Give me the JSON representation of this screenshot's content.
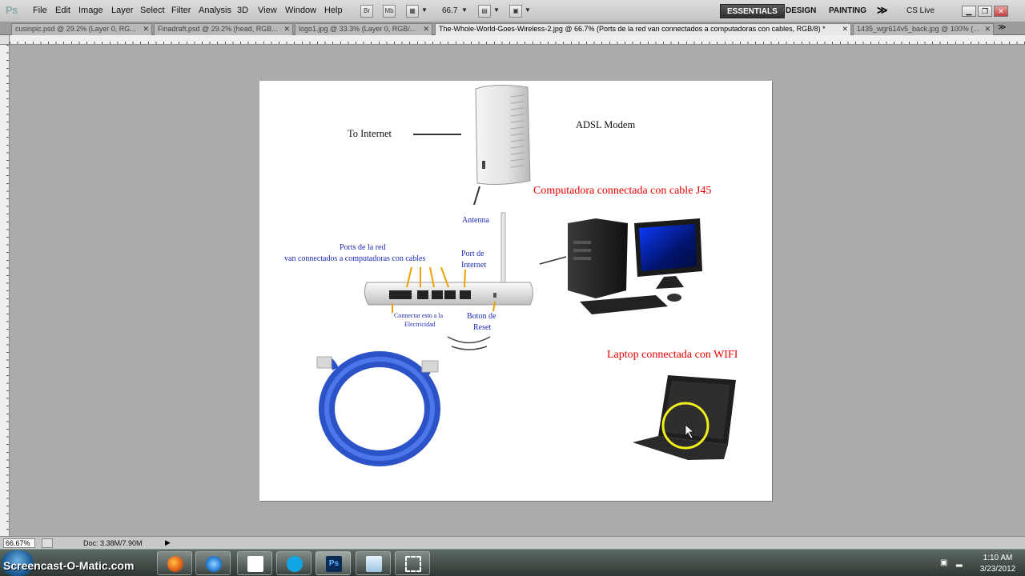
{
  "menubar": {
    "logo": "Ps",
    "items": [
      "File",
      "Edit",
      "Image",
      "Layer",
      "Select",
      "Filter",
      "Analysis",
      "3D",
      "View",
      "Window",
      "Help"
    ],
    "zoom_value": "66.7",
    "bridge_label": "Br",
    "minibridge_label": "Mb",
    "workspaces": [
      "ESSENTIALS",
      "DESIGN",
      "PAINTING"
    ],
    "more_label": "≫",
    "cs_live": "CS Live"
  },
  "tabs": [
    "cusinpic.psd @ 29.2% (Layer 0, RG...",
    "Finadraft.psd @ 29.2% (head, RGB...",
    "logo1.jpg @ 33.3% (Layer 0, RGB/...",
    "The-Whole-World-Goes-Wireless-2.jpg @ 66.7% (Ports de la red van connectados a computadoras con cables, RGB/8) *",
    "1435_wgr614v5_back.jpg @ 100% (..."
  ],
  "canvas": {
    "to_internet": "To Internet",
    "adsl_modem": "ADSL Modem",
    "computer_caption": "Computadora connectada con cable J45",
    "laptop_caption": "Laptop connectada con WIFI",
    "antenna": "Antenna",
    "ports_line1": "Ports de la red",
    "ports_line2": "van connectados a computadoras con cables",
    "port_internet_1": "Port de",
    "port_internet_2": "Internet",
    "power_1": "Connectar esto a la",
    "power_2": "Electricidad",
    "reset_1": "Boton de",
    "reset_2": "Reset"
  },
  "statusbar": {
    "zoom": "66.67%",
    "doc": "Doc: 3.38M/7.90M"
  },
  "taskbar": {
    "watermark": "Screencast-O-Matic.com",
    "time": "1:10 AM",
    "date": "3/23/2012"
  }
}
